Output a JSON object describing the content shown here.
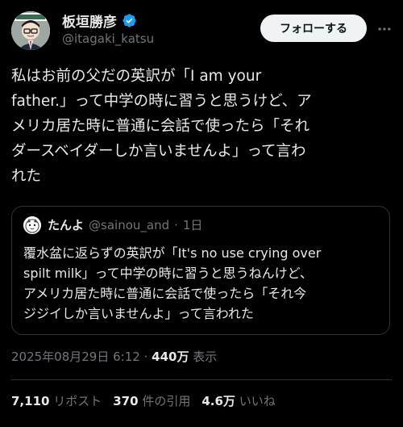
{
  "author": {
    "display_name": "板垣勝彦",
    "handle": "@itagaki_katsu",
    "verified_icon": "verified-badge-icon",
    "verified_color": "#1d9bf0"
  },
  "follow_button_label": "フォローする",
  "more_icon": "more-options-icon",
  "tweet_text_lines": [
    "私はお前の父だの英訳が「I am your",
    "father.」って中学の時に習うと思うけど、ア",
    "メリカ居た時に普通に会話で使ったら「それ",
    "ダースベイダーしか言いませんよ」って言わ",
    "れた"
  ],
  "quote": {
    "display_name": "たんよ",
    "handle": "@sainou_and",
    "separator": "·",
    "age": "1日",
    "text_lines": [
      "覆水盆に返らずの英訳が「It's no use crying over",
      "spilt milk」って中学の時に習うと思うねんけど、",
      "アメリカ居た時に普通に会話で使ったら「それ今",
      "ジジイしか言いませんよ」って言われた"
    ]
  },
  "timestamp": "2025年08月29日 6:12",
  "dot": "·",
  "views_count": "440万",
  "views_label": "表示",
  "stats": {
    "reposts_count": "7,110",
    "reposts_label": "リポスト",
    "quotes_count": "370",
    "quotes_label": "件の引用",
    "likes_count": "4.6万",
    "likes_label": "いいね"
  },
  "colors": {
    "background": "#000000",
    "text_primary": "#e7e9ea",
    "text_secondary": "#71767b",
    "border": "#2f3336",
    "follow_button_bg": "#eff3f4"
  }
}
